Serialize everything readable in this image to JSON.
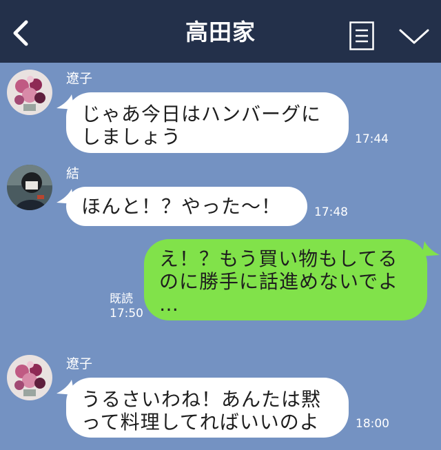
{
  "header": {
    "title": "高田家",
    "back_icon": "chevron-left-icon",
    "menu_icon": "notes-menu-icon",
    "expand_icon": "chevron-down-icon"
  },
  "messages": [
    {
      "sender": "遼子",
      "text": "じゃあ今日はハンバーグに\nしましょう",
      "time": "17:44"
    },
    {
      "sender": "結",
      "text": "ほんと！？やった〜！",
      "time": "17:48"
    },
    {
      "sender": "",
      "text": "え！？もう買い物もしてる\nのに勝手に話進めないでよ\n…",
      "read_label": "既読",
      "time": "17:50"
    },
    {
      "sender": "遼子",
      "text": "うるさいわね！あんたは黙\nって料理してればいいのよ",
      "time": "18:00"
    }
  ],
  "colors": {
    "background": "#7492c2",
    "header": "#23304a",
    "incoming_bubble": "#ffffff",
    "outgoing_bubble": "#81e24a"
  }
}
